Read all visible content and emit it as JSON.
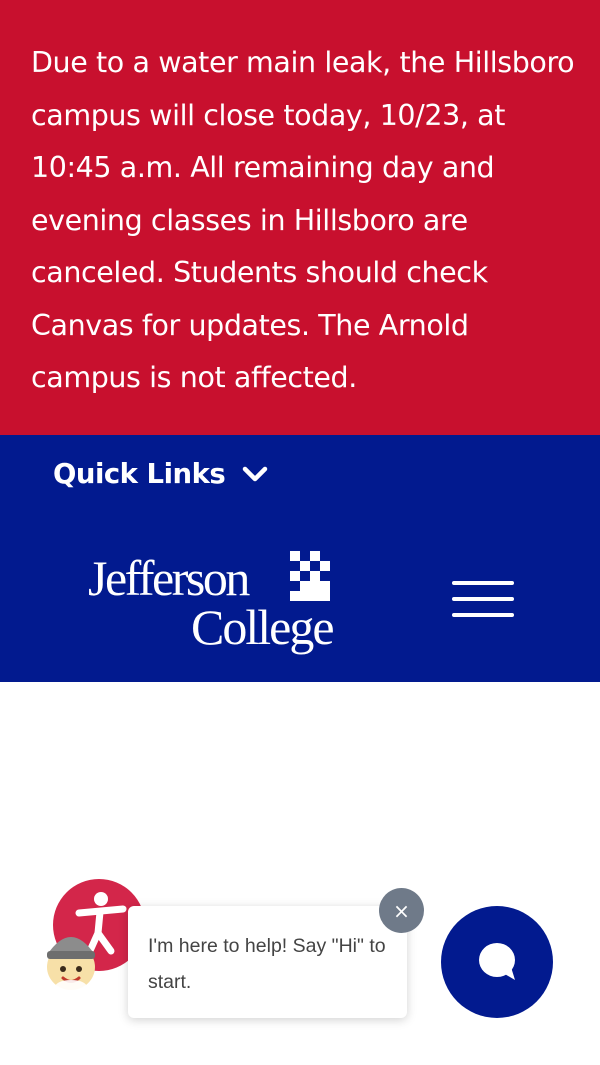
{
  "alert": {
    "message": "Due to a water main leak, the Hillsboro campus will close today, 10/23, at 10:45 a.m. All remaining day and evening classes in Hillsboro are canceled. Students should check Canvas for updates. The Arnold campus is not affected."
  },
  "nav": {
    "quick_links_label": "Quick Links",
    "logo_text_line1": "Jefferson",
    "logo_text_line2": "College"
  },
  "chat": {
    "greeting": "I'm here to help! Say \"Hi\" to start.",
    "close_symbol": "×"
  },
  "colors": {
    "alert_bg": "#c8102e",
    "brand_blue": "#021a8f",
    "accessibility_red": "#d3264a",
    "close_gray": "#6f7a89"
  },
  "icons": {
    "quick_links": "chevron-down-icon",
    "menu": "hamburger-menu-icon",
    "accessibility": "accessibility-person-icon",
    "chat": "chat-bubble-icon",
    "close": "close-icon",
    "avatar": "helper-avatar-icon"
  }
}
